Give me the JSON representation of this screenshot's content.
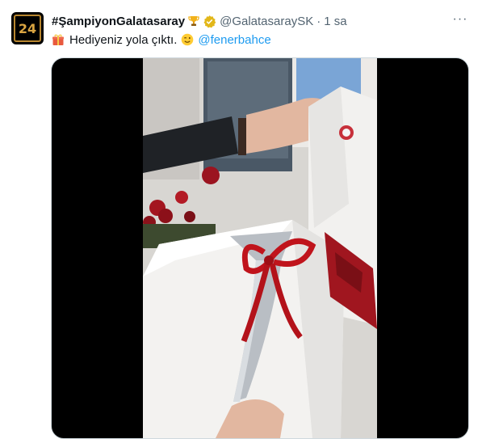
{
  "tweet": {
    "display_name": "#ŞampiyonGalatasaray",
    "handle": "@GalatasaraySK",
    "separator": "·",
    "time": "1 sa",
    "avatar_text": "24",
    "text_main": "Hediyeniz yola çıktı.",
    "mention": "@fenerbahce",
    "more_label": "···"
  },
  "icons": {
    "trophy": "trophy-icon",
    "verified": "verified-badge-icon",
    "gift": "gift-icon",
    "wink": "winking-face-icon",
    "more": "more-icon"
  },
  "colors": {
    "link": "#1d9bf0",
    "secondary_text": "#536471",
    "verified_gold": "#e2b719",
    "ribbon": "#c0141c",
    "club_red": "#a0161f"
  }
}
